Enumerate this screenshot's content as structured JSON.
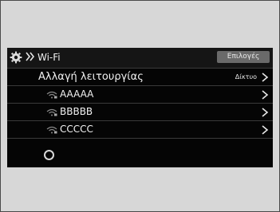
{
  "header": {
    "title": "Wi-Fi",
    "options_label": "Επιλογές",
    "icon": "gear-icon",
    "separator_icon": "double-chevron-right-icon"
  },
  "mode_row": {
    "label": "Αλλαγή λειτουργίας",
    "value": "Δίκτυο"
  },
  "networks": [
    {
      "name": "AAAAA"
    },
    {
      "name": "BBBBB"
    },
    {
      "name": "CCCCC"
    }
  ],
  "status": {
    "icon": "loading-spinner-icon"
  },
  "colors": {
    "screen": "#050505",
    "header": "#151515",
    "button": "#6a6a6a",
    "background": "#d7d7d7"
  }
}
